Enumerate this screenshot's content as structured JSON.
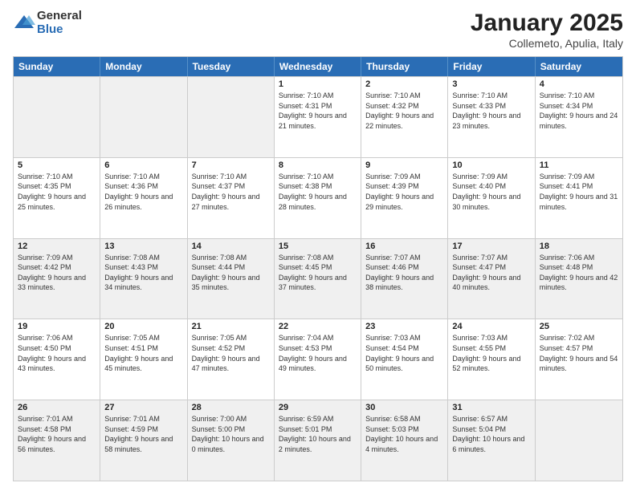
{
  "logo": {
    "general": "General",
    "blue": "Blue"
  },
  "header": {
    "month": "January 2025",
    "location": "Collemeto, Apulia, Italy"
  },
  "weekdays": [
    "Sunday",
    "Monday",
    "Tuesday",
    "Wednesday",
    "Thursday",
    "Friday",
    "Saturday"
  ],
  "weeks": [
    [
      {
        "day": "",
        "sunrise": "",
        "sunset": "",
        "daylight": "",
        "shaded": true
      },
      {
        "day": "",
        "sunrise": "",
        "sunset": "",
        "daylight": "",
        "shaded": true
      },
      {
        "day": "",
        "sunrise": "",
        "sunset": "",
        "daylight": "",
        "shaded": true
      },
      {
        "day": "1",
        "sunrise": "Sunrise: 7:10 AM",
        "sunset": "Sunset: 4:31 PM",
        "daylight": "Daylight: 9 hours and 21 minutes.",
        "shaded": false
      },
      {
        "day": "2",
        "sunrise": "Sunrise: 7:10 AM",
        "sunset": "Sunset: 4:32 PM",
        "daylight": "Daylight: 9 hours and 22 minutes.",
        "shaded": false
      },
      {
        "day": "3",
        "sunrise": "Sunrise: 7:10 AM",
        "sunset": "Sunset: 4:33 PM",
        "daylight": "Daylight: 9 hours and 23 minutes.",
        "shaded": false
      },
      {
        "day": "4",
        "sunrise": "Sunrise: 7:10 AM",
        "sunset": "Sunset: 4:34 PM",
        "daylight": "Daylight: 9 hours and 24 minutes.",
        "shaded": false
      }
    ],
    [
      {
        "day": "5",
        "sunrise": "Sunrise: 7:10 AM",
        "sunset": "Sunset: 4:35 PM",
        "daylight": "Daylight: 9 hours and 25 minutes.",
        "shaded": false
      },
      {
        "day": "6",
        "sunrise": "Sunrise: 7:10 AM",
        "sunset": "Sunset: 4:36 PM",
        "daylight": "Daylight: 9 hours and 26 minutes.",
        "shaded": false
      },
      {
        "day": "7",
        "sunrise": "Sunrise: 7:10 AM",
        "sunset": "Sunset: 4:37 PM",
        "daylight": "Daylight: 9 hours and 27 minutes.",
        "shaded": false
      },
      {
        "day": "8",
        "sunrise": "Sunrise: 7:10 AM",
        "sunset": "Sunset: 4:38 PM",
        "daylight": "Daylight: 9 hours and 28 minutes.",
        "shaded": false
      },
      {
        "day": "9",
        "sunrise": "Sunrise: 7:09 AM",
        "sunset": "Sunset: 4:39 PM",
        "daylight": "Daylight: 9 hours and 29 minutes.",
        "shaded": false
      },
      {
        "day": "10",
        "sunrise": "Sunrise: 7:09 AM",
        "sunset": "Sunset: 4:40 PM",
        "daylight": "Daylight: 9 hours and 30 minutes.",
        "shaded": false
      },
      {
        "day": "11",
        "sunrise": "Sunrise: 7:09 AM",
        "sunset": "Sunset: 4:41 PM",
        "daylight": "Daylight: 9 hours and 31 minutes.",
        "shaded": false
      }
    ],
    [
      {
        "day": "12",
        "sunrise": "Sunrise: 7:09 AM",
        "sunset": "Sunset: 4:42 PM",
        "daylight": "Daylight: 9 hours and 33 minutes.",
        "shaded": true
      },
      {
        "day": "13",
        "sunrise": "Sunrise: 7:08 AM",
        "sunset": "Sunset: 4:43 PM",
        "daylight": "Daylight: 9 hours and 34 minutes.",
        "shaded": true
      },
      {
        "day": "14",
        "sunrise": "Sunrise: 7:08 AM",
        "sunset": "Sunset: 4:44 PM",
        "daylight": "Daylight: 9 hours and 35 minutes.",
        "shaded": true
      },
      {
        "day": "15",
        "sunrise": "Sunrise: 7:08 AM",
        "sunset": "Sunset: 4:45 PM",
        "daylight": "Daylight: 9 hours and 37 minutes.",
        "shaded": true
      },
      {
        "day": "16",
        "sunrise": "Sunrise: 7:07 AM",
        "sunset": "Sunset: 4:46 PM",
        "daylight": "Daylight: 9 hours and 38 minutes.",
        "shaded": true
      },
      {
        "day": "17",
        "sunrise": "Sunrise: 7:07 AM",
        "sunset": "Sunset: 4:47 PM",
        "daylight": "Daylight: 9 hours and 40 minutes.",
        "shaded": true
      },
      {
        "day": "18",
        "sunrise": "Sunrise: 7:06 AM",
        "sunset": "Sunset: 4:48 PM",
        "daylight": "Daylight: 9 hours and 42 minutes.",
        "shaded": true
      }
    ],
    [
      {
        "day": "19",
        "sunrise": "Sunrise: 7:06 AM",
        "sunset": "Sunset: 4:50 PM",
        "daylight": "Daylight: 9 hours and 43 minutes.",
        "shaded": false
      },
      {
        "day": "20",
        "sunrise": "Sunrise: 7:05 AM",
        "sunset": "Sunset: 4:51 PM",
        "daylight": "Daylight: 9 hours and 45 minutes.",
        "shaded": false
      },
      {
        "day": "21",
        "sunrise": "Sunrise: 7:05 AM",
        "sunset": "Sunset: 4:52 PM",
        "daylight": "Daylight: 9 hours and 47 minutes.",
        "shaded": false
      },
      {
        "day": "22",
        "sunrise": "Sunrise: 7:04 AM",
        "sunset": "Sunset: 4:53 PM",
        "daylight": "Daylight: 9 hours and 49 minutes.",
        "shaded": false
      },
      {
        "day": "23",
        "sunrise": "Sunrise: 7:03 AM",
        "sunset": "Sunset: 4:54 PM",
        "daylight": "Daylight: 9 hours and 50 minutes.",
        "shaded": false
      },
      {
        "day": "24",
        "sunrise": "Sunrise: 7:03 AM",
        "sunset": "Sunset: 4:55 PM",
        "daylight": "Daylight: 9 hours and 52 minutes.",
        "shaded": false
      },
      {
        "day": "25",
        "sunrise": "Sunrise: 7:02 AM",
        "sunset": "Sunset: 4:57 PM",
        "daylight": "Daylight: 9 hours and 54 minutes.",
        "shaded": false
      }
    ],
    [
      {
        "day": "26",
        "sunrise": "Sunrise: 7:01 AM",
        "sunset": "Sunset: 4:58 PM",
        "daylight": "Daylight: 9 hours and 56 minutes.",
        "shaded": true
      },
      {
        "day": "27",
        "sunrise": "Sunrise: 7:01 AM",
        "sunset": "Sunset: 4:59 PM",
        "daylight": "Daylight: 9 hours and 58 minutes.",
        "shaded": true
      },
      {
        "day": "28",
        "sunrise": "Sunrise: 7:00 AM",
        "sunset": "Sunset: 5:00 PM",
        "daylight": "Daylight: 10 hours and 0 minutes.",
        "shaded": true
      },
      {
        "day": "29",
        "sunrise": "Sunrise: 6:59 AM",
        "sunset": "Sunset: 5:01 PM",
        "daylight": "Daylight: 10 hours and 2 minutes.",
        "shaded": true
      },
      {
        "day": "30",
        "sunrise": "Sunrise: 6:58 AM",
        "sunset": "Sunset: 5:03 PM",
        "daylight": "Daylight: 10 hours and 4 minutes.",
        "shaded": true
      },
      {
        "day": "31",
        "sunrise": "Sunrise: 6:57 AM",
        "sunset": "Sunset: 5:04 PM",
        "daylight": "Daylight: 10 hours and 6 minutes.",
        "shaded": true
      },
      {
        "day": "",
        "sunrise": "",
        "sunset": "",
        "daylight": "",
        "shaded": true
      }
    ]
  ]
}
